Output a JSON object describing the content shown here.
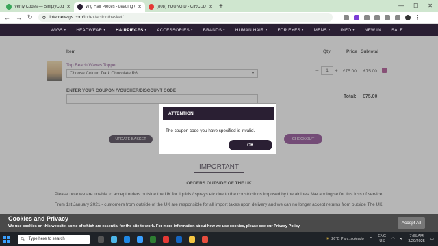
{
  "browser": {
    "tabs": [
      {
        "label": "Verify Codes — SimplyCodes",
        "favicon_color": "#3aa65a",
        "active": false
      },
      {
        "label": "Wig Hair Pieces - Leading UK",
        "favicon_color": "#2a1f33",
        "active": true
      },
      {
        "label": "(808) YOUNG D - CIRCULO",
        "favicon_color": "#e53935",
        "active": false
      }
    ],
    "new_tab": "+",
    "url_host": "internetwigs.com",
    "url_path": "/index/action/basket/"
  },
  "site_nav": [
    {
      "label": "WIGS",
      "chevron": true
    },
    {
      "label": "HEADWEAR",
      "chevron": true
    },
    {
      "label": "HAIRPIECES",
      "chevron": true,
      "active": true
    },
    {
      "label": "ACCESSORIES",
      "chevron": true
    },
    {
      "label": "BRANDS",
      "chevron": true
    },
    {
      "label": "HUMAN HAIR",
      "chevron": true
    },
    {
      "label": "FOR EYES",
      "chevron": true
    },
    {
      "label": "MENS",
      "chevron": true
    },
    {
      "label": "INFO",
      "chevron": true
    },
    {
      "label": "NEW IN",
      "chevron": false
    },
    {
      "label": "SALE",
      "chevron": false
    }
  ],
  "basket": {
    "headers": {
      "item": "Item",
      "qty": "Qty",
      "price": "Price",
      "subtotal": "Subtotal"
    },
    "product_name": "Top Beach Waves Topper",
    "colour_select": "Choose Colour:  Dark Chocolate R6",
    "qty_minus": "−",
    "qty": "1",
    "qty_plus": "+",
    "price": "£75.00",
    "subtotal": "£75.00",
    "coupon_label": "ENTER YOUR COUPON /VOUCHER/DISCOUNT CODE",
    "total_label": "Total:",
    "total_value": "£75.00",
    "update_button": "UPDATE BASKET",
    "checkout_button": "CHECKOUT"
  },
  "info": {
    "important_heading": "IMPORTANT",
    "orders_heading": "ORDERS OUTSIDE OF THE UK",
    "paragraph1": "Please note we are unable to accept orders outside the UK for liquids / sprays etc due to the constrictions imposed by the airlines.  We apologise for this loss of service.",
    "paragraph2": "From 1st January 2021 - customers from outside of the UK are responsible for  all import taxes upon delivery and we can no longer accept returns from outside The UK."
  },
  "modal": {
    "title": "ATTENTION",
    "message": "The coupon code you have specified is invalid.",
    "ok_button": "OK"
  },
  "cookie": {
    "title": "Cookies and Privacy",
    "text": "We use cookies on this website, some of which are essential for the site to work. For more information about how we use cookies, please see our ",
    "link": "Privacy Policy",
    "link_suffix": ".",
    "accept_button": "Accept All"
  },
  "taskbar": {
    "search_placeholder": "Type here to search",
    "weather": "26°C  Parc. soleado",
    "lang_line1": "ENG",
    "lang_line2": "US",
    "time": "7:35 AM",
    "date": "3/29/2025"
  },
  "colors": {
    "brand_dark": "#2a1f33",
    "brand_purple": "#7a2b80",
    "product_link": "#6f2c76"
  }
}
